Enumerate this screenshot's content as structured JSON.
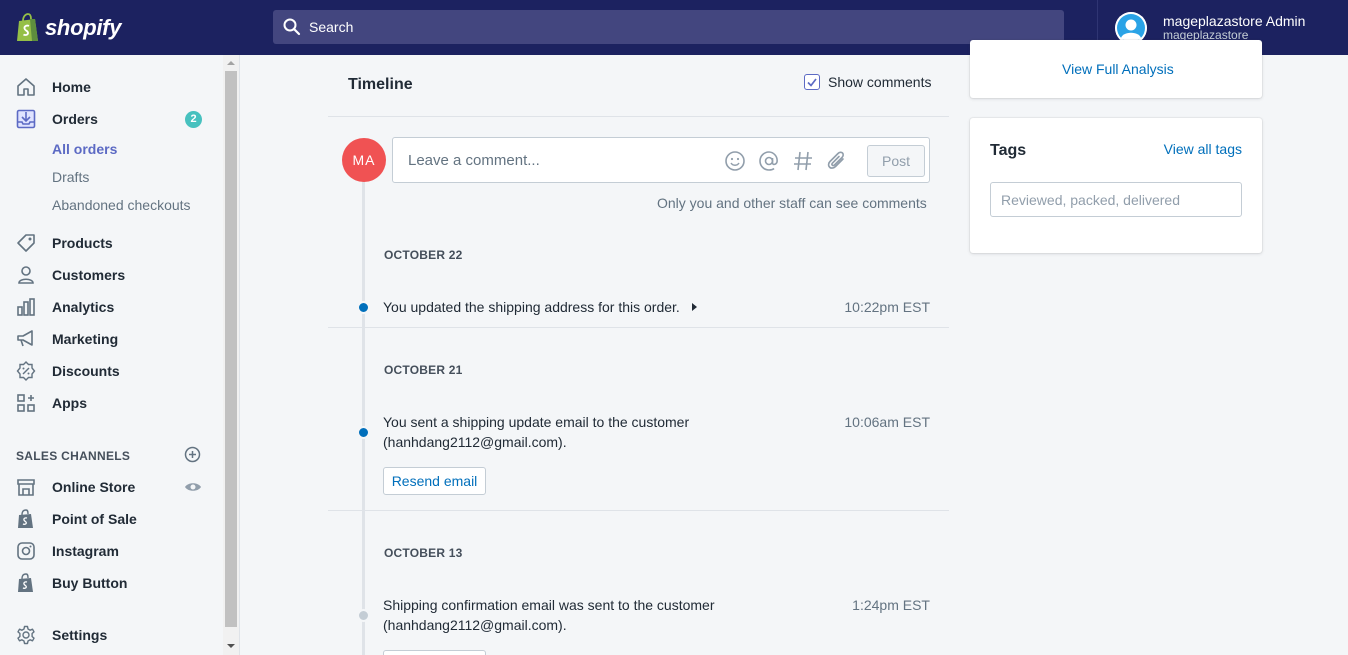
{
  "brand": {
    "name": "shopify"
  },
  "search": {
    "placeholder": "Search"
  },
  "user": {
    "name": "mageplazastore Admin",
    "store": "mageplazastore"
  },
  "sidebar": {
    "items": [
      {
        "label": "Home",
        "icon": "home-icon"
      },
      {
        "label": "Orders",
        "icon": "orders-icon",
        "badge": "2"
      },
      {
        "label": "Products",
        "icon": "tag-icon"
      },
      {
        "label": "Customers",
        "icon": "person-icon"
      },
      {
        "label": "Analytics",
        "icon": "bar-chart-icon"
      },
      {
        "label": "Marketing",
        "icon": "megaphone-icon"
      },
      {
        "label": "Discounts",
        "icon": "discount-icon"
      },
      {
        "label": "Apps",
        "icon": "apps-icon"
      }
    ],
    "order_subitems": [
      "All orders",
      "Drafts",
      "Abandoned checkouts"
    ],
    "sales_channels_title": "SALES CHANNELS",
    "channels": [
      {
        "label": "Online Store",
        "icon": "store-icon"
      },
      {
        "label": "Point of Sale",
        "icon": "shopify-bag-icon"
      },
      {
        "label": "Instagram",
        "icon": "instagram-icon"
      },
      {
        "label": "Buy Button",
        "icon": "shopify-bag-icon"
      }
    ],
    "settings_label": "Settings"
  },
  "timeline": {
    "title": "Timeline",
    "show_comments_label": "Show comments",
    "show_comments_checked": true,
    "avatar_initials": "MA",
    "comment_placeholder": "Leave a comment...",
    "post_label": "Post",
    "comment_note": "Only you and other staff can see comments",
    "groups": [
      {
        "date": "OCTOBER 22",
        "event": "You updated the shipping address for this order.",
        "time": "10:22pm EST"
      },
      {
        "date": "OCTOBER 21",
        "event_line1": "You sent a shipping update email to the customer",
        "event_line2": "(hanhdang2112@gmail.com).",
        "time": "10:06am EST",
        "button": "Resend email"
      },
      {
        "date": "OCTOBER 13",
        "event_line1": "Shipping confirmation email was sent to the customer",
        "event_line2": "(hanhdang2112@gmail.com).",
        "time": "1:24pm EST"
      }
    ]
  },
  "analysis": {
    "link": "View Full Analysis"
  },
  "tags": {
    "title": "Tags",
    "view_all": "View all tags",
    "placeholder": "Reviewed, packed, delivered"
  },
  "colors": {
    "topbar": "#1c2260",
    "accent": "#5c6ac4",
    "link": "#006fbb",
    "badge": "#47c1bf",
    "avatar": "#f05253"
  }
}
